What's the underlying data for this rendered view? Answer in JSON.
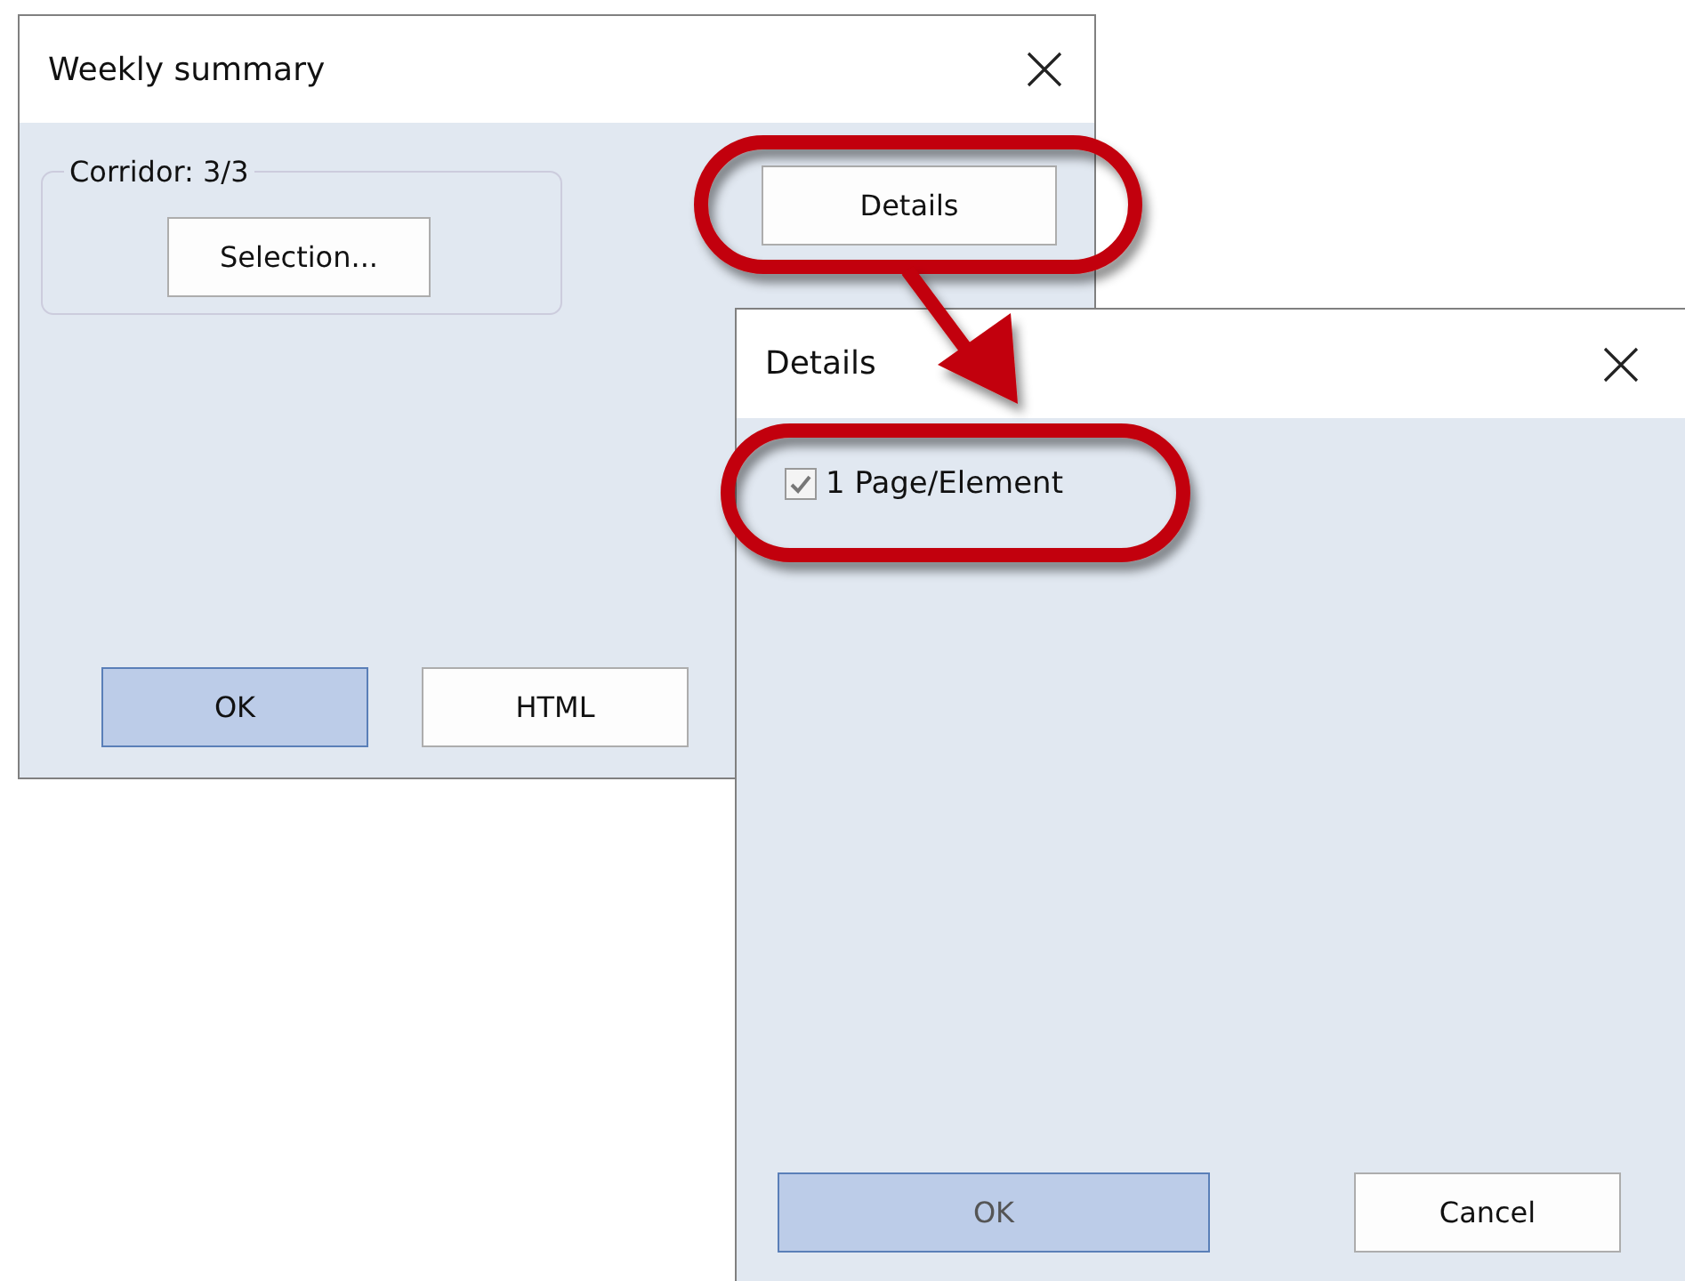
{
  "main_dialog": {
    "title": "Weekly summary",
    "group": {
      "legend": "Corridor: 3/3",
      "button": "Selection..."
    },
    "details_button": "Details",
    "buttons": [
      {
        "label": "OK",
        "default": true,
        "disabled": false
      },
      {
        "label": "HTML",
        "default": false,
        "disabled": false
      }
    ]
  },
  "details_dialog": {
    "title": "Details",
    "checkbox": {
      "label": "1 Page/Element",
      "checked": true
    },
    "buttons": [
      {
        "label": "OK",
        "default": true,
        "disabled": true
      },
      {
        "label": "Cancel",
        "default": false,
        "disabled": false
      }
    ]
  }
}
